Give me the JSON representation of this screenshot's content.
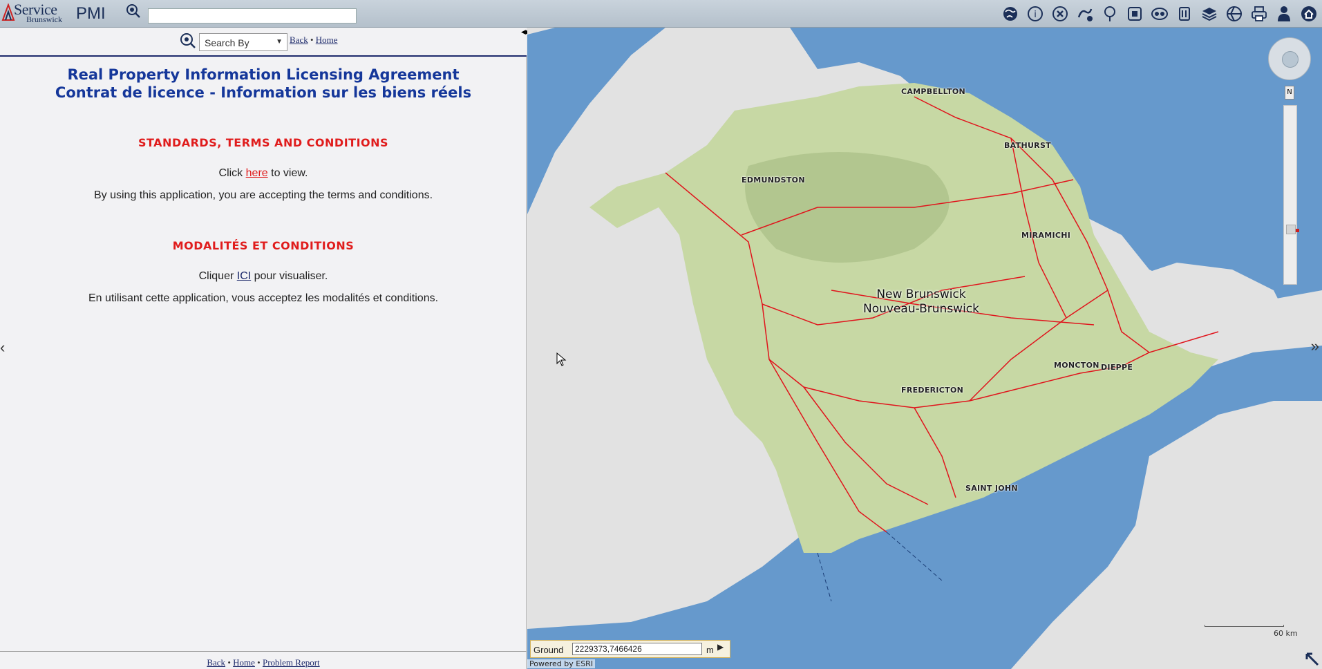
{
  "header": {
    "brand_line1": "Service",
    "brand_line2": "Brunswick",
    "app_name": "PMI",
    "search_value": "",
    "colors": {
      "brand": "#1b2f58",
      "toolbar_bg": "#c0cad4"
    }
  },
  "toolbar": {
    "icons": [
      "globe-icon",
      "identify-icon",
      "clear-icon",
      "measure-icon",
      "pushpin-icon",
      "extent-icon",
      "overview-icon",
      "legend-icon",
      "layers-icon",
      "basemap-icon",
      "print-icon",
      "user-icon",
      "home-icon"
    ]
  },
  "left_panel": {
    "search_by_label": "Search By",
    "back_link": "Back",
    "home_link": "Home",
    "separator": "•",
    "title_en": "Real Property Information Licensing Agreement",
    "title_fr": "Contrat de licence - Information sur les biens réels",
    "section_en": "STANDARDS, TERMS AND CONDITIONS",
    "click_prefix": "Click",
    "here_link": "here",
    "click_suffix": "to view.",
    "accept_en": "By using this application, you are accepting the terms and conditions.",
    "section_fr": "MODALITÉS ET CONDITIONS",
    "cliquer_prefix": "Cliquer",
    "ici_link": "ICI",
    "cliquer_suffix": "pour visualiser.",
    "accept_fr": "En utilisant cette application, vous acceptez les modalités et conditions.",
    "footer_back": "Back",
    "footer_home": "Home",
    "footer_problem": "Problem Report",
    "colors": {
      "title": "#15379a",
      "section": "#e01c1c",
      "divider": "#1d2a6b"
    }
  },
  "map": {
    "province_en": "New Brunswick",
    "province_fr": "Nouveau-Brunswick",
    "cities": [
      "CAMPBELLTON",
      "BATHURST",
      "EDMUNDSTON",
      "MIRAMICHI",
      "MONCTON",
      "DIEPPE",
      "FREDERICTON",
      "SAINT JOHN"
    ],
    "scale_label": "60 km",
    "coord_label": "Ground",
    "coord_value": "2229373,7466426",
    "coord_unit": "m",
    "powered_by": "Powered by ESRI",
    "north_label": "N",
    "colors": {
      "water": "#6699cc",
      "land": "#e2e2e2",
      "province": "#c7d8a4",
      "roads": "#e0141c"
    }
  }
}
